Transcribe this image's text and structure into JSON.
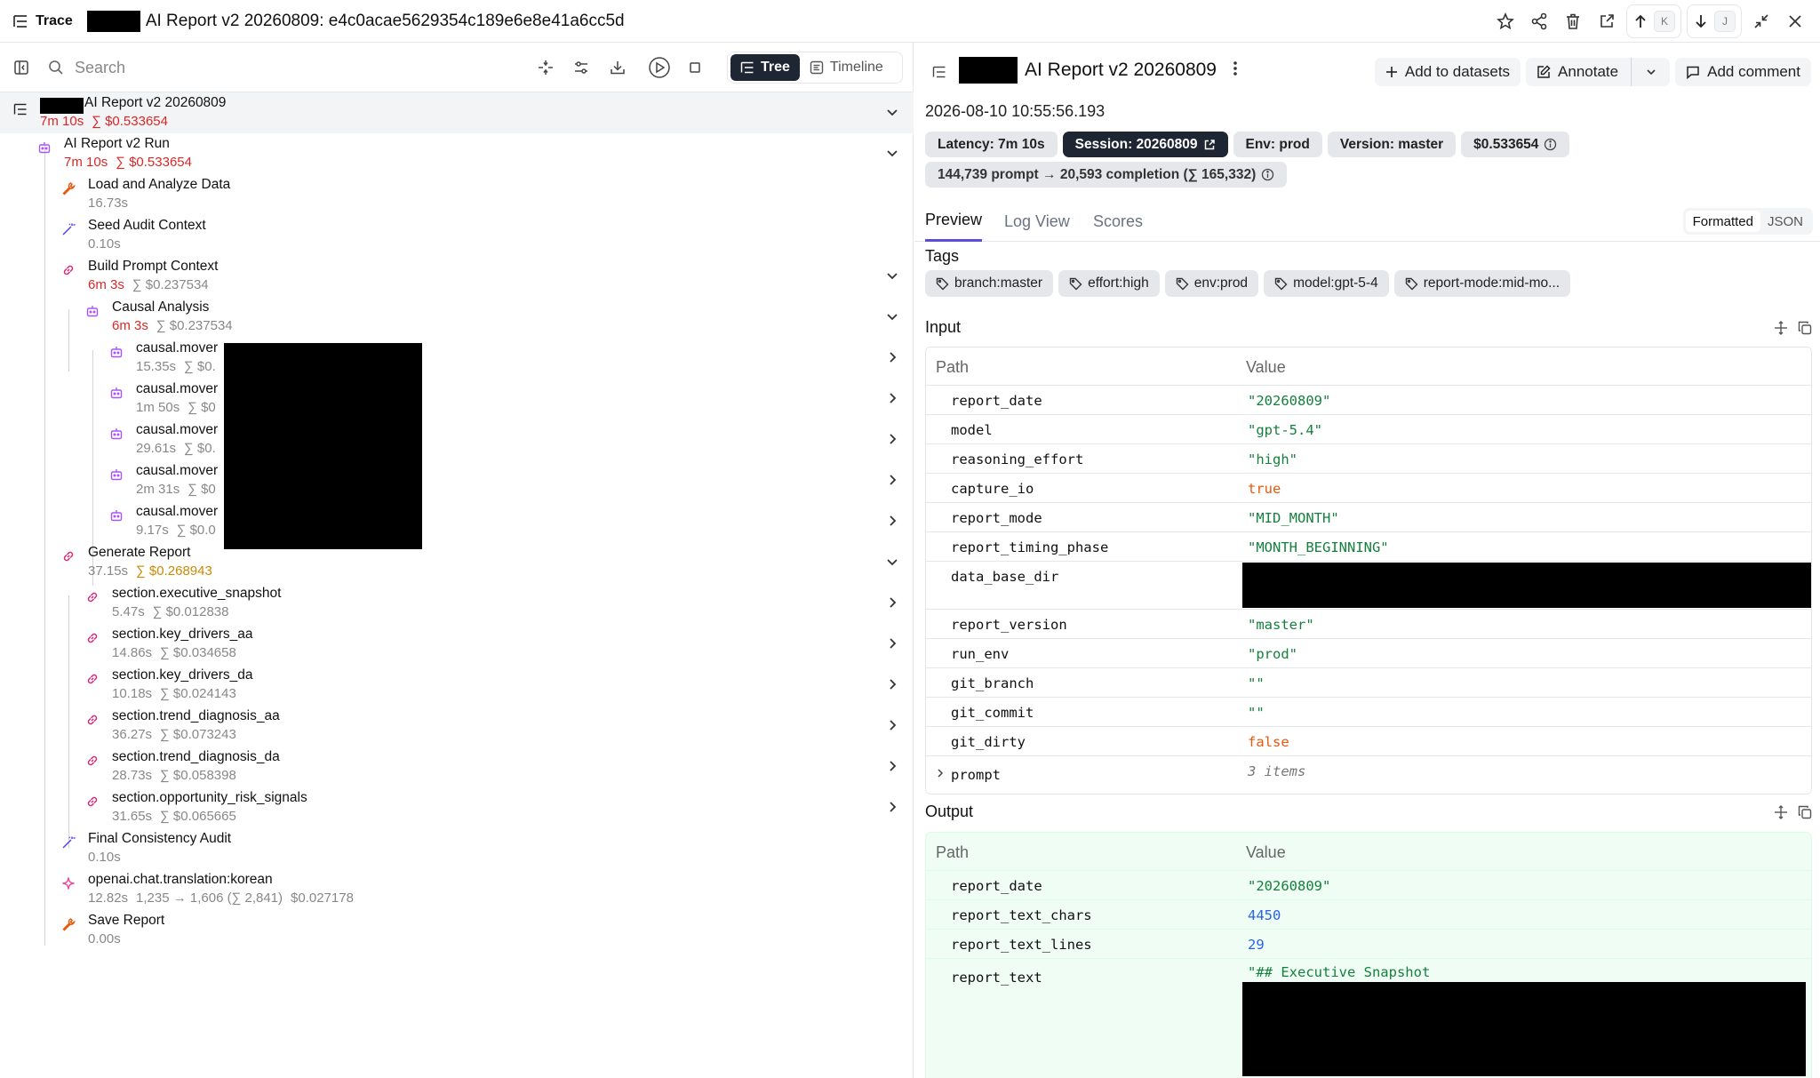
{
  "topbar": {
    "trace_label": "Trace",
    "title": "AI Report v2 20260809: e4c0acae5629354c189e6e8e41a6cc5d",
    "kbd_up": "K",
    "kbd_down": "J"
  },
  "toolbar": {
    "search_placeholder": "Search",
    "view_tree": "Tree",
    "view_timeline": "Timeline"
  },
  "tree": [
    {
      "name": "AI Report v2 20260809",
      "latency": "7m 10s",
      "cost": "∑ $0.533654",
      "icon": "trace-icon"
    },
    {
      "name": "AI Report v2 Run",
      "latency": "7m 10s",
      "cost": "∑ $0.533654",
      "icon": "agent-icon"
    },
    {
      "name": "Load and Analyze Data",
      "latency": "16.73s",
      "icon": "tool-icon"
    },
    {
      "name": "Seed Audit Context",
      "latency": "0.10s",
      "icon": "wand-icon"
    },
    {
      "name": "Build Prompt Context",
      "latency": "6m 3s",
      "cost": "∑ $0.237534",
      "icon": "chain-icon"
    },
    {
      "name": "Causal Analysis",
      "latency": "6m 3s",
      "cost": "∑ $0.237534",
      "icon": "agent-icon"
    },
    {
      "name": "causal.mover",
      "latency": "15.35s",
      "cost": "∑ $0.",
      "icon": "agent-icon"
    },
    {
      "name": "causal.mover",
      "latency": "1m 50s",
      "cost": "∑ $0",
      "icon": "agent-icon"
    },
    {
      "name": "causal.mover",
      "latency": "29.61s",
      "cost": "∑ $0.",
      "icon": "agent-icon"
    },
    {
      "name": "causal.mover",
      "latency": "2m 31s",
      "cost": "∑ $0",
      "icon": "agent-icon"
    },
    {
      "name": "causal.mover",
      "latency": "9.17s",
      "cost": "∑ $0.0",
      "icon": "agent-icon"
    },
    {
      "name": "Generate Report",
      "latency": "37.15s",
      "cost": "∑ $0.268943",
      "icon": "chain-icon"
    },
    {
      "name": "section.executive_snapshot",
      "latency": "5.47s",
      "cost": "∑ $0.012838",
      "icon": "chain-icon"
    },
    {
      "name": "section.key_drivers_aa",
      "latency": "14.86s",
      "cost": "∑ $0.034658",
      "icon": "chain-icon"
    },
    {
      "name": "section.key_drivers_da",
      "latency": "10.18s",
      "cost": "∑ $0.024143",
      "icon": "chain-icon"
    },
    {
      "name": "section.trend_diagnosis_aa",
      "latency": "36.27s",
      "cost": "∑ $0.073243",
      "icon": "chain-icon"
    },
    {
      "name": "section.trend_diagnosis_da",
      "latency": "28.73s",
      "cost": "∑ $0.058398",
      "icon": "chain-icon"
    },
    {
      "name": "section.opportunity_risk_signals",
      "latency": "31.65s",
      "cost": "∑ $0.065665",
      "icon": "chain-icon"
    },
    {
      "name": "Final Consistency Audit",
      "latency": "0.10s",
      "icon": "wand-icon"
    },
    {
      "name": "openai.chat.translation:korean",
      "latency": "12.82s",
      "tokens": "1,235 → 1,606 (∑ 2,841)",
      "cost_plain": "$0.027178",
      "icon": "llm-icon"
    },
    {
      "name": "Save Report",
      "latency": "0.00s",
      "icon": "tool-icon"
    }
  ],
  "detail": {
    "title": "AI Report v2 20260809",
    "add_datasets": "Add to datasets",
    "annotate": "Annotate",
    "add_comment": "Add comment",
    "timestamp": "2026-08-10 10:55:56.193",
    "badges": {
      "latency": "Latency: 7m 10s",
      "session": "Session: 20260809",
      "env": "Env: prod",
      "version": "Version: master",
      "cost": "$0.533654",
      "tokens": "144,739 prompt → 20,593 completion (∑ 165,332)"
    },
    "tabs": {
      "preview": "Preview",
      "log": "Log View",
      "scores": "Scores"
    },
    "format": {
      "formatted": "Formatted",
      "json": "JSON"
    },
    "tags_heading": "Tags",
    "tags": [
      "branch:master",
      "effort:high",
      "env:prod",
      "model:gpt-5-4",
      "report-mode:mid-mo..."
    ],
    "input_heading": "Input",
    "output_heading": "Output",
    "col_path": "Path",
    "col_value": "Value",
    "input_rows": [
      {
        "k": "report_date",
        "v": "\"20260809\""
      },
      {
        "k": "model",
        "v": "\"gpt-5.4\""
      },
      {
        "k": "reasoning_effort",
        "v": "\"high\""
      },
      {
        "k": "capture_io",
        "v": "true"
      },
      {
        "k": "report_mode",
        "v": "\"MID_MONTH\""
      },
      {
        "k": "report_timing_phase",
        "v": "\"MONTH_BEGINNING\""
      },
      {
        "k": "data_base_dir",
        "v": ""
      },
      {
        "k": "report_version",
        "v": "\"master\""
      },
      {
        "k": "run_env",
        "v": "\"prod\""
      },
      {
        "k": "git_branch",
        "v": "\"\""
      },
      {
        "k": "git_commit",
        "v": "\"\""
      },
      {
        "k": "git_dirty",
        "v": "false"
      },
      {
        "k": "prompt",
        "v": "3 items"
      }
    ],
    "output_rows": [
      {
        "k": "report_date",
        "v": "\"20260809\""
      },
      {
        "k": "report_text_chars",
        "v": "4450"
      },
      {
        "k": "report_text_lines",
        "v": "29"
      },
      {
        "k": "report_text",
        "v": "\"## Executive Snapshot"
      }
    ]
  }
}
